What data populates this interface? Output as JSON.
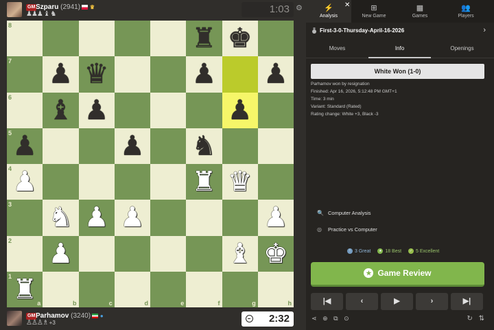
{
  "top_player": {
    "title": "GM",
    "name": "Szparu",
    "rating": "(2941)",
    "captured": "♟♟♟ ♝ ♞",
    "clock": "1:03"
  },
  "bottom_player": {
    "title": "GM",
    "name": "Parhamov",
    "rating": "(3240)",
    "captured": "♙♙♙♗",
    "advantage": "+3",
    "clock": "2:32"
  },
  "board": {
    "files": [
      "a",
      "b",
      "c",
      "d",
      "e",
      "f",
      "g",
      "h"
    ],
    "ranks": [
      "8",
      "7",
      "6",
      "5",
      "4",
      "3",
      "2",
      "1"
    ],
    "highlighted_squares": [
      "g7",
      "g6"
    ],
    "pieces": [
      {
        "square": "f8",
        "type": "rook",
        "color": "black",
        "glyph": "♜"
      },
      {
        "square": "g8",
        "type": "king",
        "color": "black",
        "glyph": "♚"
      },
      {
        "square": "b7",
        "type": "pawn",
        "color": "black",
        "glyph": "♟"
      },
      {
        "square": "c7",
        "type": "queen",
        "color": "black",
        "glyph": "♛"
      },
      {
        "square": "f7",
        "type": "pawn",
        "color": "black",
        "glyph": "♟"
      },
      {
        "square": "h7",
        "type": "pawn",
        "color": "black",
        "glyph": "♟"
      },
      {
        "square": "b6",
        "type": "bishop",
        "color": "black",
        "glyph": "♝"
      },
      {
        "square": "c6",
        "type": "pawn",
        "color": "black",
        "glyph": "♟"
      },
      {
        "square": "g6",
        "type": "pawn",
        "color": "black",
        "glyph": "♟"
      },
      {
        "square": "a5",
        "type": "pawn",
        "color": "black",
        "glyph": "♟"
      },
      {
        "square": "d5",
        "type": "pawn",
        "color": "black",
        "glyph": "♟"
      },
      {
        "square": "f5",
        "type": "knight",
        "color": "black",
        "glyph": "♞"
      },
      {
        "square": "a4",
        "type": "pawn",
        "color": "white",
        "glyph": "♟"
      },
      {
        "square": "f4",
        "type": "rook",
        "color": "white",
        "glyph": "♜"
      },
      {
        "square": "g4",
        "type": "queen",
        "color": "white",
        "glyph": "♛"
      },
      {
        "square": "b3",
        "type": "knight",
        "color": "white",
        "glyph": "♞"
      },
      {
        "square": "c3",
        "type": "pawn",
        "color": "white",
        "glyph": "♟"
      },
      {
        "square": "d3",
        "type": "pawn",
        "color": "white",
        "glyph": "♟"
      },
      {
        "square": "h3",
        "type": "pawn",
        "color": "white",
        "glyph": "♟"
      },
      {
        "square": "b2",
        "type": "pawn",
        "color": "white",
        "glyph": "♟"
      },
      {
        "square": "g2",
        "type": "bishop",
        "color": "white",
        "glyph": "♝"
      },
      {
        "square": "h2",
        "type": "king",
        "color": "white",
        "glyph": "♚"
      },
      {
        "square": "a1",
        "type": "rook",
        "color": "white",
        "glyph": "♜"
      }
    ]
  },
  "tabs": [
    {
      "label": "Analysis",
      "icon": "lightning-icon",
      "glyph": "⚡"
    },
    {
      "label": "New Game",
      "icon": "plus-square-icon",
      "glyph": "⊞"
    },
    {
      "label": "Games",
      "icon": "chessboard-icon",
      "glyph": "▦"
    },
    {
      "label": "Players",
      "icon": "players-icon",
      "glyph": "👥"
    }
  ],
  "game_title": "First-3-0-Thursday-April-16-2026",
  "subtabs": [
    "Moves",
    "Info",
    "Openings"
  ],
  "info": {
    "result": "White Won (1-0)",
    "lines": [
      "Parhamov won by resignation",
      "Finished: Apr 16, 2026, 5:12:48 PM GMT+1",
      "Time: 3 min",
      "Variant: Standard (Rated)",
      "Rating change: White +3, Black -3"
    ]
  },
  "actions": {
    "computer_analysis": "Computer Analysis",
    "practice": "Practice vs Computer"
  },
  "badges": [
    {
      "label": "3 Great",
      "color": "#749bbf",
      "glyph": "!"
    },
    {
      "label": "18 Best",
      "color": "#81b64c",
      "glyph": "★"
    },
    {
      "label": "5 Excellent",
      "color": "#96bc4b",
      "glyph": "👍"
    }
  ],
  "review_button": "Game Review",
  "nav_buttons": [
    "|◀",
    "‹",
    "▶",
    "›",
    "▶|"
  ],
  "colors": {
    "light_square": "#eeeed2",
    "dark_square": "#769656",
    "accent_green": "#81b64c"
  }
}
